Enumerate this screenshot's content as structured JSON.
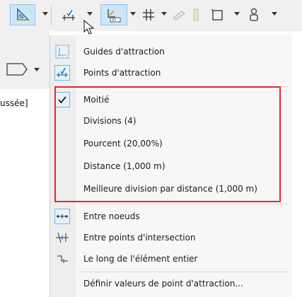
{
  "toolbar": {
    "buttons": [
      {
        "name": "triangle-ruler-icon",
        "active": true
      },
      {
        "name": "snap-guides-icon",
        "active": false
      },
      {
        "name": "xy-coordinate-icon",
        "active": true
      },
      {
        "name": "grid-snap-icon",
        "active": false
      },
      {
        "name": "pencil-icon",
        "active": false
      },
      {
        "name": "rectangle-icon",
        "active": false
      },
      {
        "name": "user-icon",
        "active": false
      }
    ]
  },
  "left_panel": {
    "shape_icon": "pentagon-outline-icon",
    "truncated_text": "ussée]"
  },
  "menu": {
    "items": [
      {
        "label": "Guides d'attraction",
        "icon": "guides-icon",
        "boxed": false
      },
      {
        "label": "Points d'attraction",
        "icon": "snap-points-icon",
        "boxed": true
      },
      {
        "label": "Moitié",
        "icon": "check-icon",
        "boxed": true
      },
      {
        "label": "Divisions (4)",
        "icon": "",
        "boxed": false
      },
      {
        "label": "Pourcent (20,00%)",
        "icon": "",
        "boxed": false
      },
      {
        "label": "Distance (1,000 m)",
        "icon": "",
        "boxed": false
      },
      {
        "label": "Meilleure division par distance (1,000 m)",
        "icon": "",
        "boxed": false
      },
      {
        "label": "Entre noeuds",
        "icon": "between-nodes-icon",
        "boxed": true
      },
      {
        "label": "Entre points d'intersection",
        "icon": "intersection-points-icon",
        "boxed": false
      },
      {
        "label": "Le long de l'élément entier",
        "icon": "along-element-icon",
        "boxed": false
      },
      {
        "label": "Définir valeurs de point d'attraction...",
        "icon": "",
        "boxed": false
      }
    ]
  },
  "colors": {
    "highlight_border": "#e8252f",
    "active_button_fill": "#cde6f7",
    "active_button_border": "#8fc2ea",
    "icon_blue": "#1e73c8"
  }
}
